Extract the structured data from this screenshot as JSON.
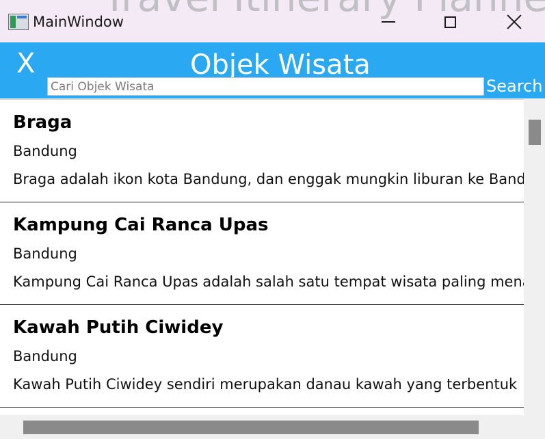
{
  "window": {
    "title": "MainWindow",
    "background_text": "Travel Itinerary Planner"
  },
  "header": {
    "back_label": "X",
    "title": "Objek Wisata",
    "search_placeholder": "Cari Objek Wisata",
    "search_value": "",
    "search_button": "Search!"
  },
  "items": [
    {
      "name": "Braga",
      "city": "Bandung",
      "desc": "Braga adalah ikon kota Bandung, dan enggak mungkin liburan ke Bandung"
    },
    {
      "name": "Kampung Cai Ranca Upas",
      "city": "Bandung",
      "desc": "Kampung Cai Ranca Upas adalah salah satu tempat wisata paling menarik"
    },
    {
      "name": "Kawah Putih Ciwidey",
      "city": "Bandung",
      "desc": "Kawah Putih Ciwidey sendiri merupakan danau kawah yang terbentuk"
    }
  ],
  "colors": {
    "header_bg": "#2aa9f2",
    "titlebar_bg": "#f4eaf5"
  }
}
